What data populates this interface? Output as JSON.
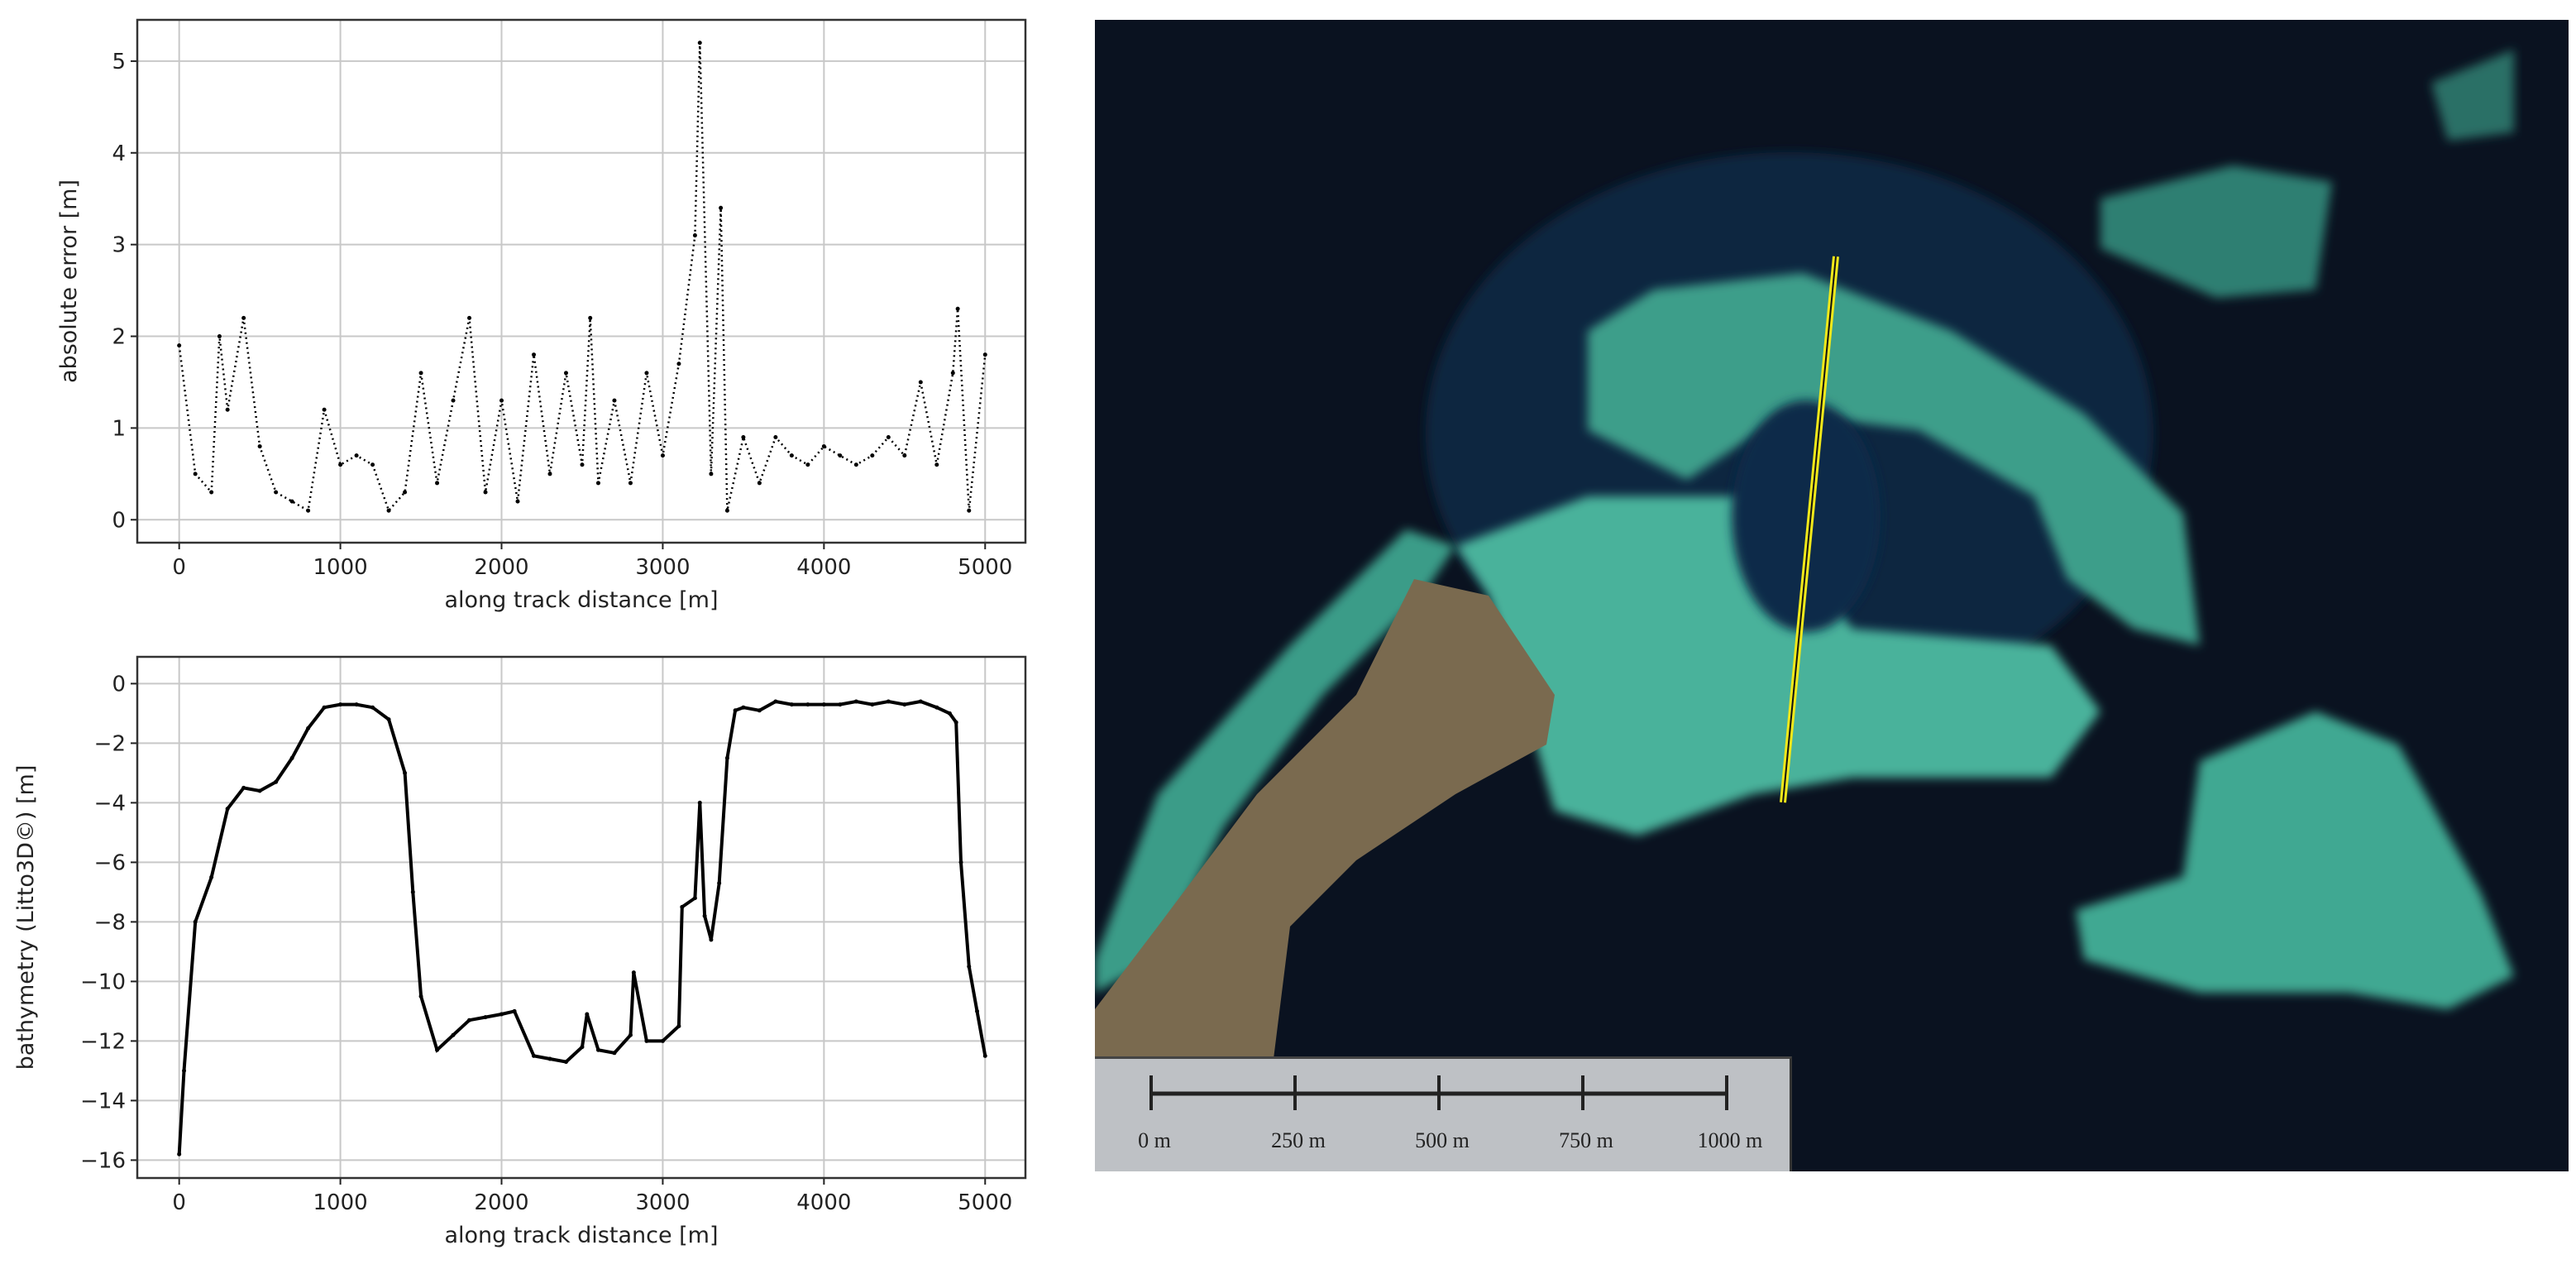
{
  "chart_data": [
    {
      "type": "scatter",
      "title": "",
      "xlabel": "along track distance [m]",
      "ylabel": "absolute error [m]",
      "xlim": [
        -260,
        5250
      ],
      "ylim": [
        -0.25,
        5.45
      ],
      "grid": true,
      "xticks": [
        "0",
        "1000",
        "2000",
        "3000",
        "4000",
        "5000"
      ],
      "yticks": [
        "0",
        "1",
        "2",
        "3",
        "4",
        "5"
      ],
      "x": [
        0,
        100,
        200,
        250,
        300,
        400,
        500,
        600,
        700,
        800,
        900,
        1000,
        1100,
        1200,
        1300,
        1400,
        1500,
        1600,
        1700,
        1800,
        1900,
        2000,
        2100,
        2200,
        2300,
        2400,
        2500,
        2550,
        2600,
        2700,
        2800,
        2900,
        3000,
        3100,
        3200,
        3230,
        3300,
        3360,
        3400,
        3500,
        3600,
        3700,
        3800,
        3900,
        4000,
        4100,
        4200,
        4300,
        4400,
        4500,
        4600,
        4700,
        4800,
        4830,
        4900,
        5000
      ],
      "y": [
        1.9,
        0.5,
        0.3,
        2.0,
        1.2,
        2.2,
        0.8,
        0.3,
        0.2,
        0.1,
        1.2,
        0.6,
        0.7,
        0.6,
        0.1,
        0.3,
        1.6,
        0.4,
        1.3,
        2.2,
        0.3,
        1.3,
        0.2,
        1.8,
        0.5,
        1.6,
        0.6,
        2.2,
        0.4,
        1.3,
        0.4,
        1.6,
        0.7,
        1.7,
        3.1,
        5.2,
        0.5,
        3.4,
        0.1,
        0.9,
        0.4,
        0.9,
        0.7,
        0.6,
        0.8,
        0.7,
        0.6,
        0.7,
        0.9,
        0.7,
        1.5,
        0.6,
        1.6,
        2.3,
        0.1,
        1.8
      ]
    },
    {
      "type": "scatter",
      "title": "",
      "xlabel": "along track distance [m]",
      "ylabel": "bathymetry (Litto3D©) [m]",
      "xlim": [
        -260,
        5250
      ],
      "ylim": [
        -16.6,
        0.9
      ],
      "grid": true,
      "xticks": [
        "0",
        "1000",
        "2000",
        "3000",
        "4000",
        "5000"
      ],
      "yticks": [
        "0",
        "−2",
        "−4",
        "−6",
        "−8",
        "−10",
        "−12",
        "−14",
        "−16"
      ],
      "x": [
        0,
        30,
        100,
        200,
        300,
        400,
        500,
        600,
        700,
        800,
        900,
        1000,
        1100,
        1200,
        1300,
        1400,
        1450,
        1500,
        1600,
        1700,
        1800,
        1900,
        2000,
        2080,
        2200,
        2300,
        2400,
        2500,
        2530,
        2600,
        2700,
        2800,
        2820,
        2900,
        3000,
        3100,
        3120,
        3200,
        3230,
        3260,
        3300,
        3350,
        3400,
        3450,
        3500,
        3600,
        3700,
        3800,
        3900,
        4000,
        4100,
        4200,
        4300,
        4400,
        4500,
        4600,
        4700,
        4780,
        4820,
        4850,
        4900,
        4950,
        5000
      ],
      "y": [
        -15.8,
        -13,
        -8,
        -6.5,
        -4.2,
        -3.5,
        -3.6,
        -3.3,
        -2.5,
        -1.5,
        -0.8,
        -0.7,
        -0.7,
        -0.8,
        -1.2,
        -3,
        -7,
        -10.5,
        -12.3,
        -11.8,
        -11.3,
        -11.2,
        -11.1,
        -11.0,
        -12.5,
        -12.6,
        -12.7,
        -12.2,
        -11.1,
        -12.3,
        -12.4,
        -11.8,
        -9.7,
        -12.0,
        -12.0,
        -11.5,
        -7.5,
        -7.2,
        -4.0,
        -7.8,
        -8.6,
        -6.7,
        -2.5,
        -0.9,
        -0.8,
        -0.9,
        -0.6,
        -0.7,
        -0.7,
        -0.7,
        -0.7,
        -0.6,
        -0.7,
        -0.6,
        -0.7,
        -0.6,
        -0.8,
        -1.0,
        -1.3,
        -6.0,
        -9.5,
        -11.0,
        -12.5
      ]
    }
  ],
  "map": {
    "scale_bar": {
      "labels": [
        "0 m",
        "250 m",
        "500 m",
        "750 m",
        "1000 m"
      ]
    },
    "colors": {
      "sea": "#0a1220",
      "reef": "#3fa892",
      "island": "#7a6a4f",
      "track": "#f0e81a"
    }
  }
}
